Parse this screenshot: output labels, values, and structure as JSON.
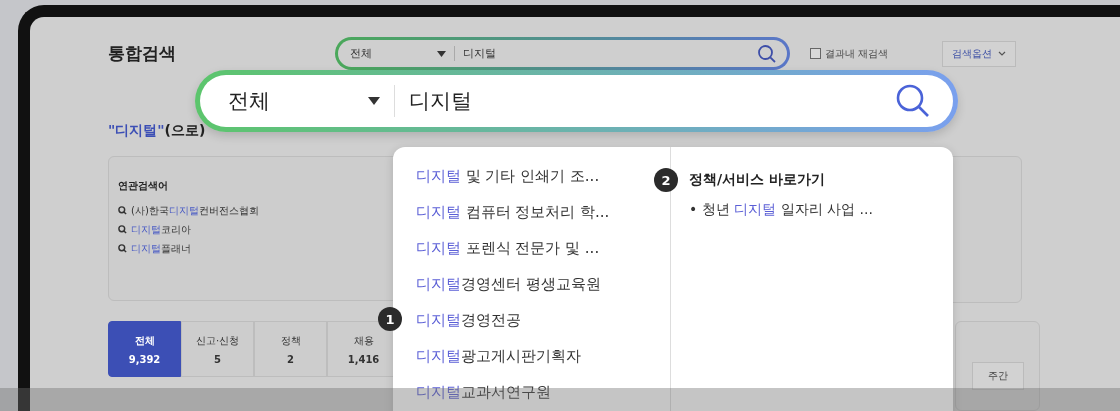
{
  "page_title": "통합검색",
  "top_search": {
    "category": "전체",
    "value": "디지털"
  },
  "refine_checkbox": {
    "label": "결과내 재검색",
    "checked": false
  },
  "options_button": "검색옵션",
  "result_heading": {
    "query": "\"디지털\"",
    "rest": "(으로)"
  },
  "related": {
    "title": "연관검색어",
    "items": [
      {
        "before": "(사)한국",
        "highlight": "디지털",
        "after": "컨버전스협회"
      },
      {
        "highlight": "디지털",
        "after": "코리아"
      },
      {
        "highlight": "디지털",
        "after": "플래너"
      }
    ]
  },
  "category_tabs": [
    {
      "label": "전체",
      "count": "9,392",
      "selected": true
    },
    {
      "label": "신고·신청",
      "count": "5",
      "selected": false
    },
    {
      "label": "정책",
      "count": "2",
      "selected": false
    },
    {
      "label": "채용",
      "count": "1,416",
      "selected": false
    }
  ],
  "period_button": "주간",
  "focused_search": {
    "category": "전체",
    "value": "디지털"
  },
  "suggestions": [
    {
      "highlight": "디지털",
      "rest": " 및 기타 인쇄기 조..."
    },
    {
      "highlight": "디지털",
      "rest": " 컴퓨터 정보처리 학..."
    },
    {
      "highlight": "디지털",
      "rest": " 포렌식 전문가 및 ..."
    },
    {
      "highlight": "디지털",
      "rest": "경영센터 평생교육원"
    },
    {
      "highlight": "디지털",
      "rest": "경영전공",
      "badge": "1"
    },
    {
      "highlight": "디지털",
      "rest": "광고게시판기획자"
    },
    {
      "highlight": "디지털",
      "rest": "교과서연구원"
    }
  ],
  "shortcuts": {
    "badge": "2",
    "title": "정책/서비스 바로가기",
    "items": [
      {
        "before": "• 청년 ",
        "highlight": "디지털",
        "after": " 일자리 사업 ..."
      }
    ]
  }
}
